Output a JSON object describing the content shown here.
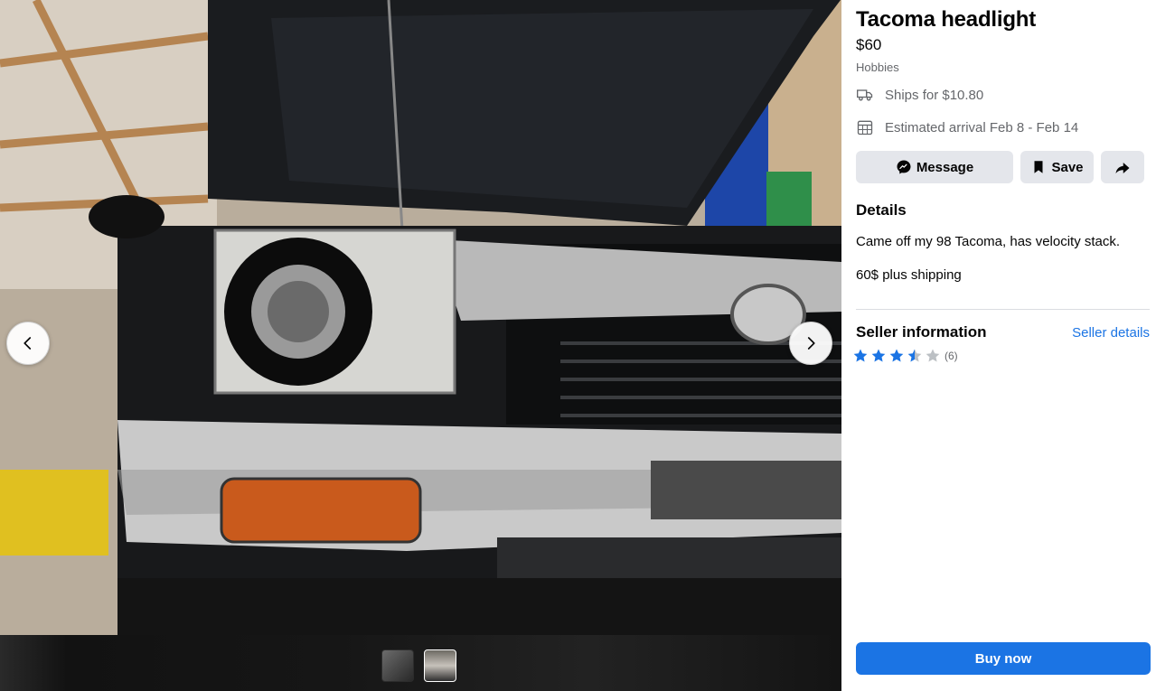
{
  "listing": {
    "title": "Tacoma headlight",
    "price": "$60",
    "category": "Hobbies",
    "shipping": "Ships for $10.80",
    "arrival": "Estimated arrival Feb 8 - Feb 14"
  },
  "actions": {
    "message_label": "Message",
    "save_label": "Save",
    "share_icon": "share-arrow-icon"
  },
  "details": {
    "heading": "Details",
    "lines": [
      "Came off my 98 Tacoma, has velocity stack.",
      "60$ plus shipping"
    ]
  },
  "seller": {
    "heading": "Seller information",
    "link_label": "Seller details",
    "rating": 3.5,
    "rating_max": 5,
    "review_count": "(6)"
  },
  "buy": {
    "label": "Buy now"
  },
  "gallery": {
    "photo_count": 2,
    "active_index": 1
  },
  "colors": {
    "accent": "#1b74e4",
    "button_bg": "#e4e6eb",
    "muted_text": "#65676b",
    "star_filled": "#1b74e4",
    "star_empty": "#bcc0c4"
  }
}
